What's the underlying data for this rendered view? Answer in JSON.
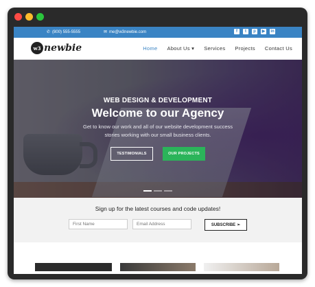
{
  "topbar": {
    "phone": "(800) 555-5555",
    "email": "me@w3newbie.com",
    "socials": [
      "facebook-icon",
      "twitter-icon",
      "pinterest-icon",
      "youtube-icon",
      "linkedin-icon"
    ]
  },
  "brand": {
    "badge": "w3",
    "name": "newbie"
  },
  "nav": {
    "items": [
      {
        "label": "Home",
        "active": true
      },
      {
        "label": "About Us ▾",
        "active": false
      },
      {
        "label": "Services",
        "active": false
      },
      {
        "label": "Projects",
        "active": false
      },
      {
        "label": "Contact Us",
        "active": false
      }
    ]
  },
  "hero": {
    "subtitle": "WEB DESIGN & DEVELOPMENT",
    "title": "Welcome to our Agency",
    "description": "Get to know our work and all of our website development success stories working with our small business clients.",
    "btn_testimonials": "TESTIMONIALS",
    "btn_projects": "OUR PROJECTS"
  },
  "signup": {
    "title": "Sign up for the latest courses and code updates!",
    "first_name_placeholder": "First Name",
    "email_placeholder": "Email Address",
    "subscribe_label": "SUBSCRIBE"
  },
  "colors": {
    "accent": "#3a84c4",
    "green": "#2bb45a"
  }
}
